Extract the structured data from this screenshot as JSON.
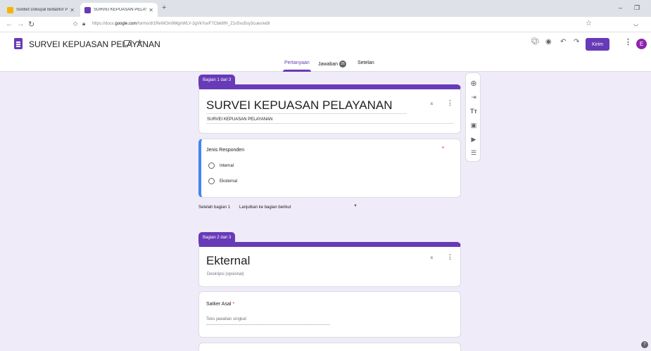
{
  "browser": {
    "tabs": [
      {
        "title": "Subbid Dokupal Bidlabfor Polri",
        "favicon_color": "#f4b400",
        "active": false
      },
      {
        "title": "SURVEI KEPUASAN PELAYANAN",
        "favicon_color": "#673ab7",
        "active": true
      }
    ],
    "new_tab": "+",
    "url_prefix": "https://docs.",
    "url_domain": "google.com",
    "url_path": "/forms/d/1ReWOm9MgnWLY-2gVkYuvF7Cbk6fH_Z1v5vu5sy3cues/edit",
    "window_controls": {
      "minimize": "–",
      "maximize": "❐"
    }
  },
  "header": {
    "doc_title": "SURVEI KEPUASAN PELAYANAN",
    "send_label": "Kirim",
    "avatar_letter": "E",
    "tabs": [
      {
        "label": "Pertanyaan",
        "active": true
      },
      {
        "label": "Jawaban",
        "active": false,
        "count": "26"
      },
      {
        "label": "Setelan",
        "active": false
      }
    ]
  },
  "section1": {
    "label": "Bagian 1 dari 3",
    "title": "SURVEI KEPUASAN PELAYANAN",
    "description": "SURVEI KEPUASAN PELAYANAN"
  },
  "question1": {
    "title": "Jenis Responden",
    "required_mark": "*",
    "options": [
      "Internal",
      "Eksternal"
    ]
  },
  "after_section": {
    "label": "Setelah bagian 1",
    "value": "Lanjutkan ke bagian berikut"
  },
  "section2": {
    "label": "Bagian 2 dari 3",
    "title": "Ekternal",
    "description": "Deskripsi (opsional)"
  },
  "question2": {
    "title": "Satker Asal",
    "required_mark": "*",
    "placeholder": "Teks jawaban singkat"
  },
  "help": "?"
}
